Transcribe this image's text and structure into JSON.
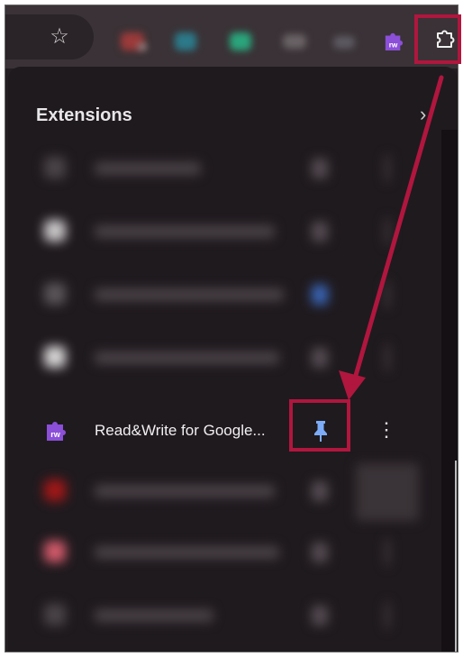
{
  "toolbar": {
    "bookmark_icon": "star-icon",
    "readwrite_icon": "readwrite-puzzle-icon",
    "readwrite_icon_text": "rw",
    "extensions_icon": "puzzle-icon"
  },
  "panel": {
    "title": "Extensions",
    "chevron": "›"
  },
  "extension": {
    "name": "Read&Write for Google...",
    "icon_text": "rw",
    "pin_icon": "pin-icon",
    "more": "⋮"
  },
  "colors": {
    "highlight": "#b0163e",
    "pin_blue": "#7cacf8",
    "readwrite_purple": "#8b4fd8",
    "panel_bg": "#1f1a1e"
  }
}
